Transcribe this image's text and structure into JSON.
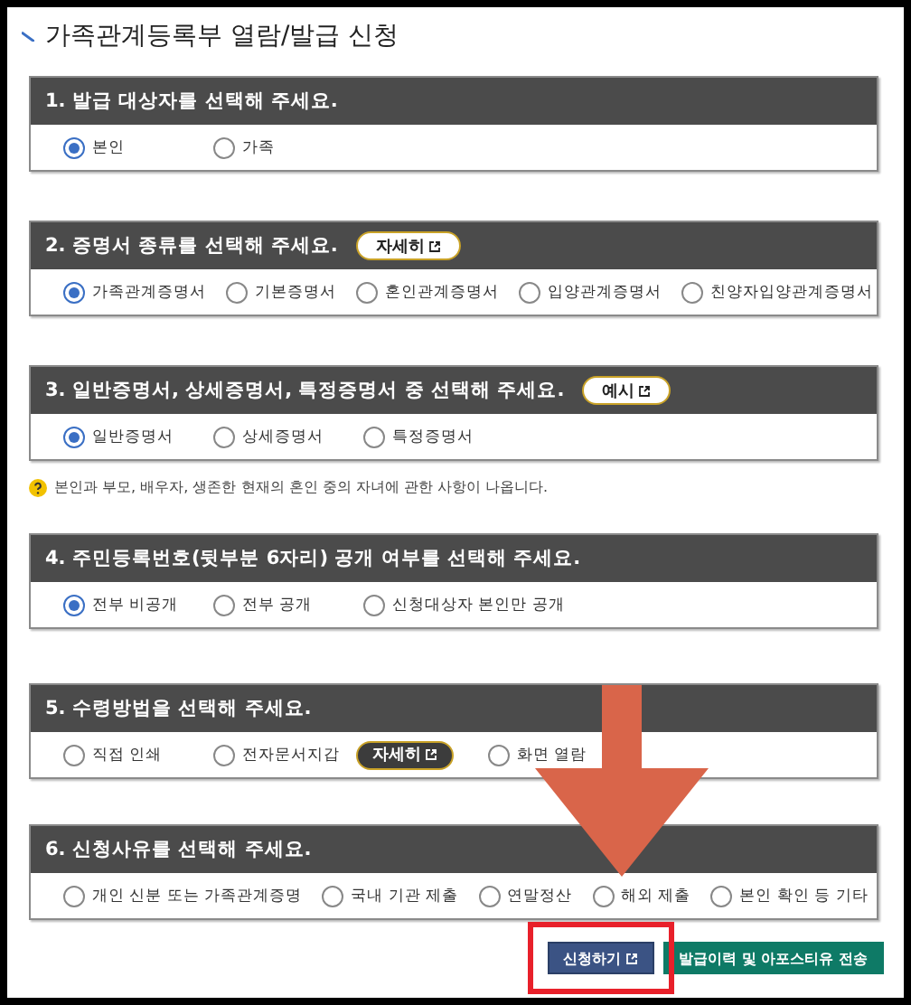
{
  "page_title": "가족관계등록부 열람/발급 신청",
  "sections": [
    {
      "title": "1. 발급 대상자를 선택해 주세요.",
      "options": [
        {
          "label": "본인",
          "selected": true
        },
        {
          "label": "가족",
          "selected": false
        }
      ]
    },
    {
      "title": "2. 증명서 종류를 선택해 주세요.",
      "button": "자세히",
      "options": [
        {
          "label": "가족관계증명서",
          "selected": true
        },
        {
          "label": "기본증명서",
          "selected": false
        },
        {
          "label": "혼인관계증명서",
          "selected": false
        },
        {
          "label": "입양관계증명서",
          "selected": false
        },
        {
          "label": "친양자입양관계증명서",
          "selected": false
        }
      ]
    },
    {
      "title": "3. 일반증명서, 상세증명서, 특정증명서 중 선택해 주세요.",
      "button": "예시",
      "options": [
        {
          "label": "일반증명서",
          "selected": true
        },
        {
          "label": "상세증명서",
          "selected": false
        },
        {
          "label": "특정증명서",
          "selected": false
        }
      ],
      "note": "본인과 부모, 배우자, 생존한 현재의 혼인 중의 자녀에 관한 사항이 나옵니다."
    },
    {
      "title": "4. 주민등록번호(뒷부분 6자리) 공개 여부를 선택해 주세요.",
      "options": [
        {
          "label": "전부 비공개",
          "selected": true
        },
        {
          "label": "전부 공개",
          "selected": false
        },
        {
          "label": "신청대상자 본인만 공개",
          "selected": false
        }
      ]
    },
    {
      "title": "5. 수령방법을 선택해 주세요.",
      "options": [
        {
          "label": "직접 인쇄",
          "selected": false
        },
        {
          "label": "전자문서지갑",
          "selected": false,
          "button": "자세히"
        },
        {
          "label": "화면 열람",
          "selected": false
        }
      ]
    },
    {
      "title": "6. 신청사유를 선택해 주세요.",
      "options": [
        {
          "label": "개인 신분 또는 가족관계증명",
          "selected": false
        },
        {
          "label": "국내 기관 제출",
          "selected": false
        },
        {
          "label": "연말정산",
          "selected": false
        },
        {
          "label": "해외 제출",
          "selected": false
        },
        {
          "label": "본인 확인 등 기타",
          "selected": false
        }
      ]
    }
  ],
  "actions": [
    {
      "label": "신청하기",
      "kind": "primary",
      "highlighted": true
    },
    {
      "label": "발급이력 및 아포스티유 전송",
      "kind": "secondary",
      "highlighted": false
    }
  ],
  "arrow_annotation": true
}
